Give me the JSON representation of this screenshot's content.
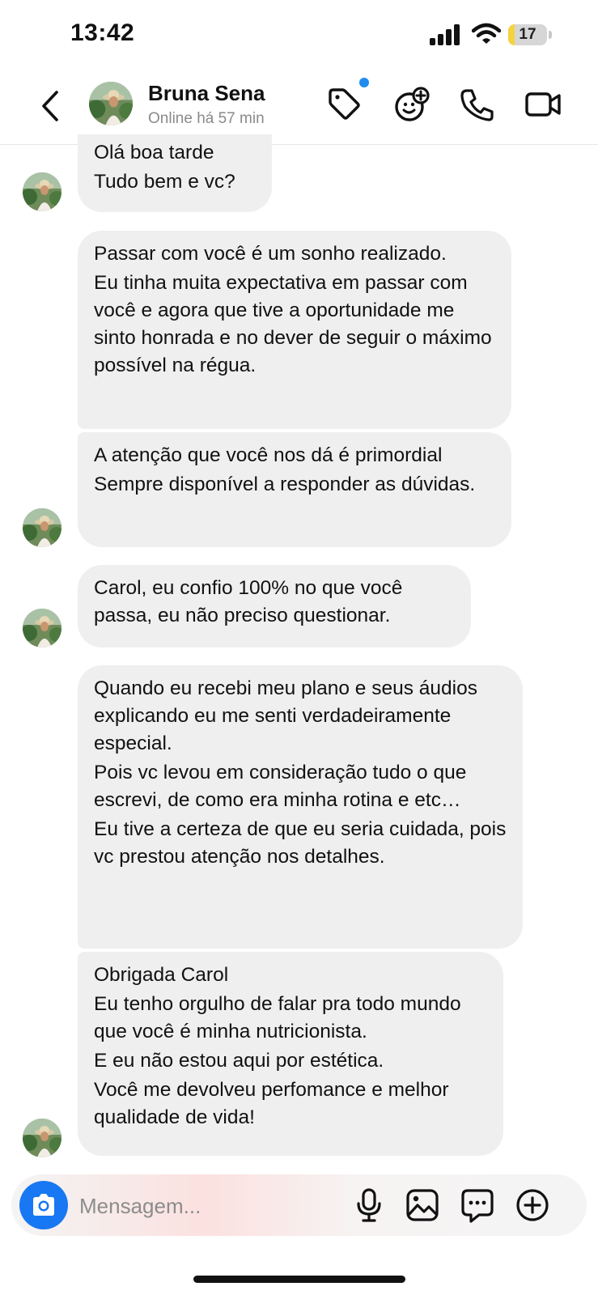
{
  "status_bar": {
    "time": "13:42",
    "battery_level": "17",
    "battery_fraction": 0.17,
    "icons": [
      "signal-icon",
      "wifi-icon",
      "battery-icon"
    ]
  },
  "header": {
    "back_icon": "chevron-left-icon",
    "contact_name": "Bruna Sena",
    "contact_status": "Online há 57 min",
    "icons": [
      "tag-icon",
      "effects-icon",
      "phone-icon",
      "video-camera-icon"
    ],
    "notification_dot_color": "#1f8cf0"
  },
  "messages": [
    {
      "lines": [
        "Olá boa tarde",
        "Tudo bem e vc?"
      ],
      "has_avatar": true
    },
    {
      "lines": [
        "Passar com você é um sonho realizado.",
        "Eu tinha muita expectativa em passar com você e agora que tive a oportunidade me sinto honrada e no dever de seguir o máximo possível na régua."
      ],
      "has_avatar": false
    },
    {
      "lines": [
        "A atenção que você nos dá é primordial",
        "Sempre disponível a responder as dúvidas."
      ],
      "has_avatar": true
    },
    {
      "lines": [
        "Carol, eu confio 100% no que você passa, eu não preciso questionar."
      ],
      "has_avatar": true
    },
    {
      "lines": [
        "Quando eu recebi meu plano e seus áudios explicando eu me senti verdadeiramente especial.",
        "Pois vc levou em consideração tudo o que escrevi, de como era minha rotina e etc…",
        "Eu tive a certeza de que eu seria cuidada, pois vc prestou atenção nos detalhes."
      ],
      "has_avatar": false
    },
    {
      "lines": [
        "Obrigada Carol",
        "Eu tenho orgulho de falar pra todo mundo que você é minha nutricionista.",
        "E eu não estou aqui por estética.",
        "Você me devolveu perfomance e melhor qualidade de vida!"
      ],
      "has_avatar": true
    }
  ],
  "composer": {
    "placeholder": "Mensagem...",
    "value": "",
    "icons": [
      "camera-icon",
      "microphone-icon",
      "image-icon",
      "sticker-icon",
      "plus-icon"
    ],
    "camera_button_color": "#1877f2"
  },
  "colors": {
    "bubble_background": "#efefef",
    "accent": "#1877f2"
  }
}
